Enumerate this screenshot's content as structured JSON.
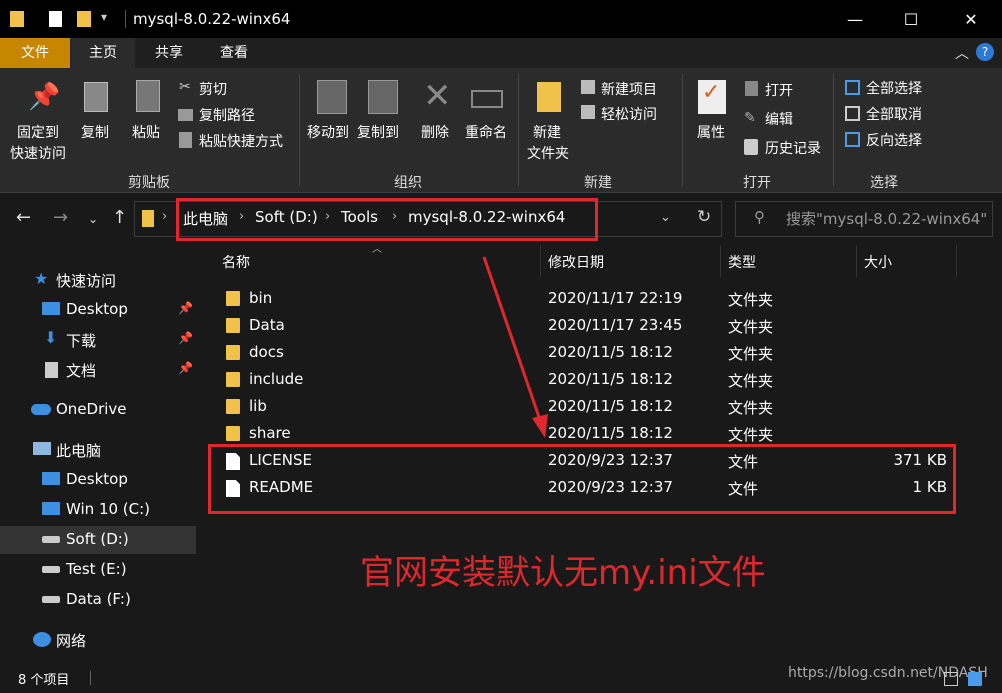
{
  "window": {
    "title": "mysql-8.0.22-winx64",
    "controls": {
      "minimize": "—",
      "maximize": "☐",
      "close": "✕"
    }
  },
  "ribbon_tabs": [
    "文件",
    "主页",
    "共享",
    "查看"
  ],
  "ribbon": {
    "clipboard": {
      "group": "剪贴板",
      "pin_line1": "固定到",
      "pin_line2": "快速访问",
      "copy": "复制",
      "paste": "粘贴",
      "cut": "剪切",
      "copy_path": "复制路径",
      "paste_shortcut": "粘贴快捷方式"
    },
    "organize": {
      "group": "组织",
      "move_to": "移动到",
      "copy_to": "复制到",
      "delete": "删除",
      "rename": "重命名"
    },
    "new": {
      "group": "新建",
      "new_folder_line1": "新建",
      "new_folder_line2": "文件夹",
      "new_item": "新建项目",
      "easy_access": "轻松访问"
    },
    "open": {
      "group": "打开",
      "properties": "属性",
      "open": "打开",
      "edit": "编辑",
      "history": "历史记录"
    },
    "select": {
      "group": "选择",
      "select_all": "全部选择",
      "select_none": "全部取消",
      "invert": "反向选择"
    }
  },
  "address": {
    "crumbs": [
      "此电脑",
      "Soft (D:)",
      "Tools",
      "mysql-8.0.22-winx64"
    ],
    "search_placeholder": "搜索\"mysql-8.0.22-winx64\""
  },
  "sidebar": {
    "quick_access": "快速访问",
    "items": [
      {
        "label": "Desktop",
        "pinned": true
      },
      {
        "label": "下载",
        "pinned": true
      },
      {
        "label": "文档",
        "pinned": true
      },
      {
        "label": "OneDrive"
      },
      {
        "label": "此电脑"
      },
      {
        "label": "Desktop"
      },
      {
        "label": "Win 10 (C:)"
      },
      {
        "label": "Soft (D:)"
      },
      {
        "label": "Test (E:)"
      },
      {
        "label": "Data (F:)"
      },
      {
        "label": "网络"
      }
    ]
  },
  "columns": [
    "名称",
    "修改日期",
    "类型",
    "大小"
  ],
  "files": [
    {
      "name": "bin",
      "date": "2020/11/17 22:19",
      "type": "文件夹",
      "size": "",
      "kind": "folder"
    },
    {
      "name": "Data",
      "date": "2020/11/17 23:45",
      "type": "文件夹",
      "size": "",
      "kind": "folder"
    },
    {
      "name": "docs",
      "date": "2020/11/5 18:12",
      "type": "文件夹",
      "size": "",
      "kind": "folder"
    },
    {
      "name": "include",
      "date": "2020/11/5 18:12",
      "type": "文件夹",
      "size": "",
      "kind": "folder"
    },
    {
      "name": "lib",
      "date": "2020/11/5 18:12",
      "type": "文件夹",
      "size": "",
      "kind": "folder"
    },
    {
      "name": "share",
      "date": "2020/11/5 18:12",
      "type": "文件夹",
      "size": "",
      "kind": "folder"
    },
    {
      "name": "LICENSE",
      "date": "2020/9/23 12:37",
      "type": "文件",
      "size": "371 KB",
      "kind": "file"
    },
    {
      "name": "README",
      "date": "2020/9/23 12:37",
      "type": "文件",
      "size": "1 KB",
      "kind": "file"
    }
  ],
  "annotation": {
    "text": "官网安装默认无my.ini文件",
    "color": "#e0272e"
  },
  "status": {
    "count": "8 个项目",
    "watermark": "https://blog.csdn.net/NDASH"
  },
  "colors": {
    "file_tab": "#c78600",
    "background": "#191919",
    "ribbon": "#2b2b2b",
    "folder": "#f0c24a",
    "annotation_red": "#e0272e"
  }
}
